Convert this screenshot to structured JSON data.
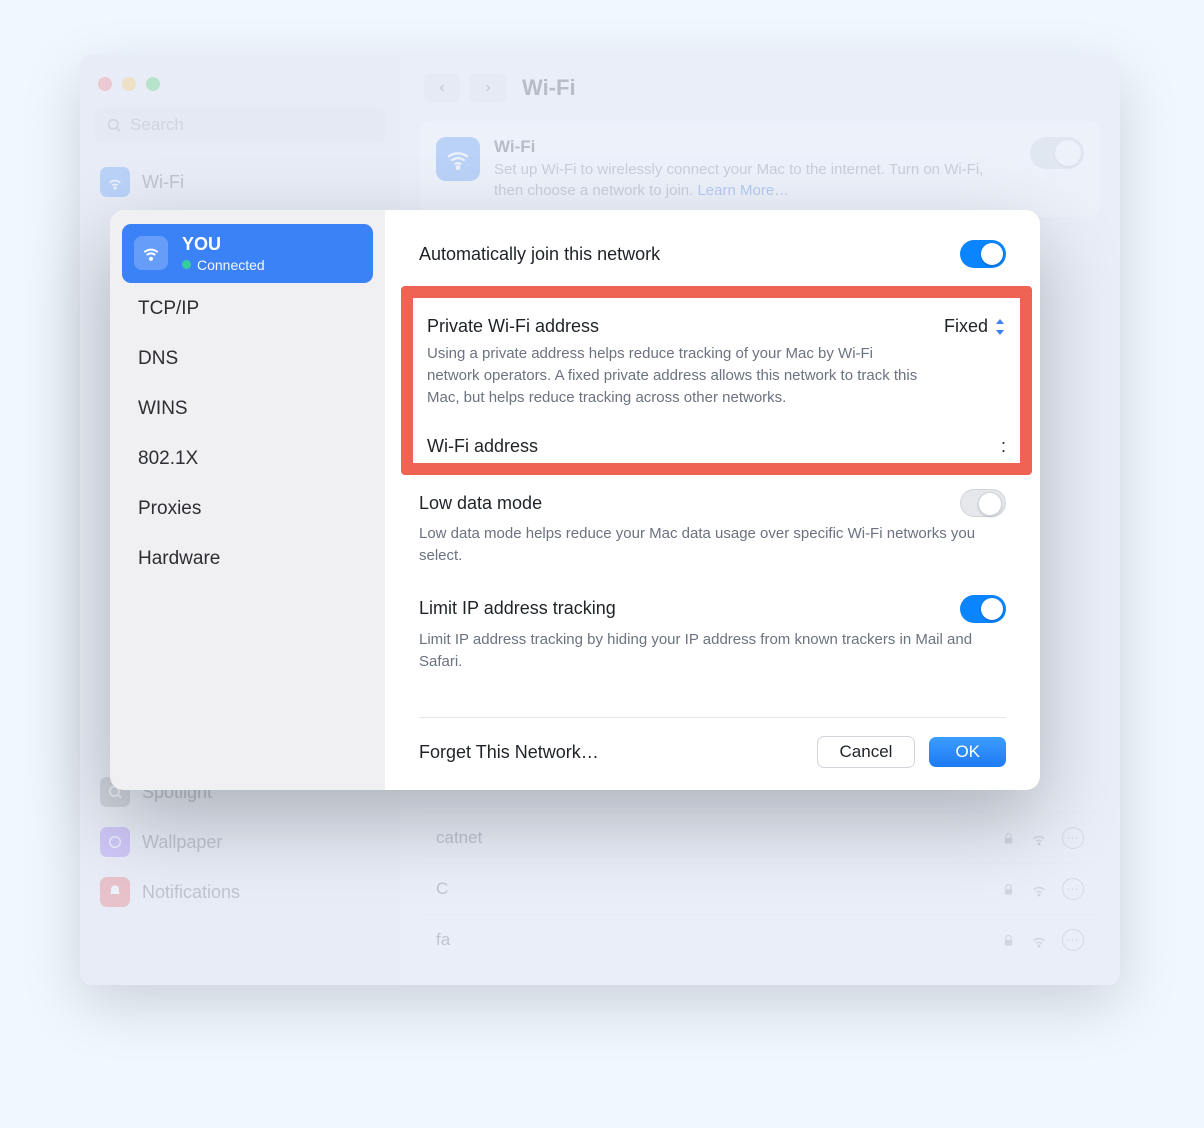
{
  "background": {
    "search_placeholder": "Search",
    "title": "Wi-Fi",
    "wifi_card": {
      "title": "Wi-Fi",
      "desc_prefix": "Set up Wi-Fi to wirelessly connect your Mac to the internet. Turn on Wi-Fi, then choose a network to join. ",
      "learn_more": "Learn More…"
    },
    "sidebar_items": [
      {
        "label": "Wi-Fi"
      },
      {
        "label": "Spotlight"
      },
      {
        "label": "Wallpaper"
      },
      {
        "label": "Notifications"
      }
    ],
    "networks": [
      {
        "name": "catnet"
      },
      {
        "name": "C"
      },
      {
        "name": "fa"
      }
    ]
  },
  "modal": {
    "network_name": "YOU",
    "status": "Connected",
    "tabs": [
      "TCP/IP",
      "DNS",
      "WINS",
      "802.1X",
      "Proxies",
      "Hardware"
    ],
    "auto_join": {
      "label": "Automatically join this network",
      "on": true
    },
    "private_addr": {
      "label": "Private Wi-Fi address",
      "value": "Fixed",
      "desc": "Using a private address helps reduce tracking of your Mac by Wi-Fi network operators. A fixed private address allows this network to track this Mac, but helps reduce tracking across other networks."
    },
    "wifi_addr": {
      "label": "Wi-Fi address",
      "value": ":"
    },
    "low_data": {
      "label": "Low data mode",
      "desc": "Low data mode helps reduce your Mac data usage over specific Wi-Fi networks you select.",
      "on": false
    },
    "limit_ip": {
      "label": "Limit IP address tracking",
      "desc": "Limit IP address tracking by hiding your IP address from known trackers in Mail and Safari.",
      "on": true
    },
    "footer": {
      "forget": "Forget This Network…",
      "cancel": "Cancel",
      "ok": "OK"
    }
  }
}
